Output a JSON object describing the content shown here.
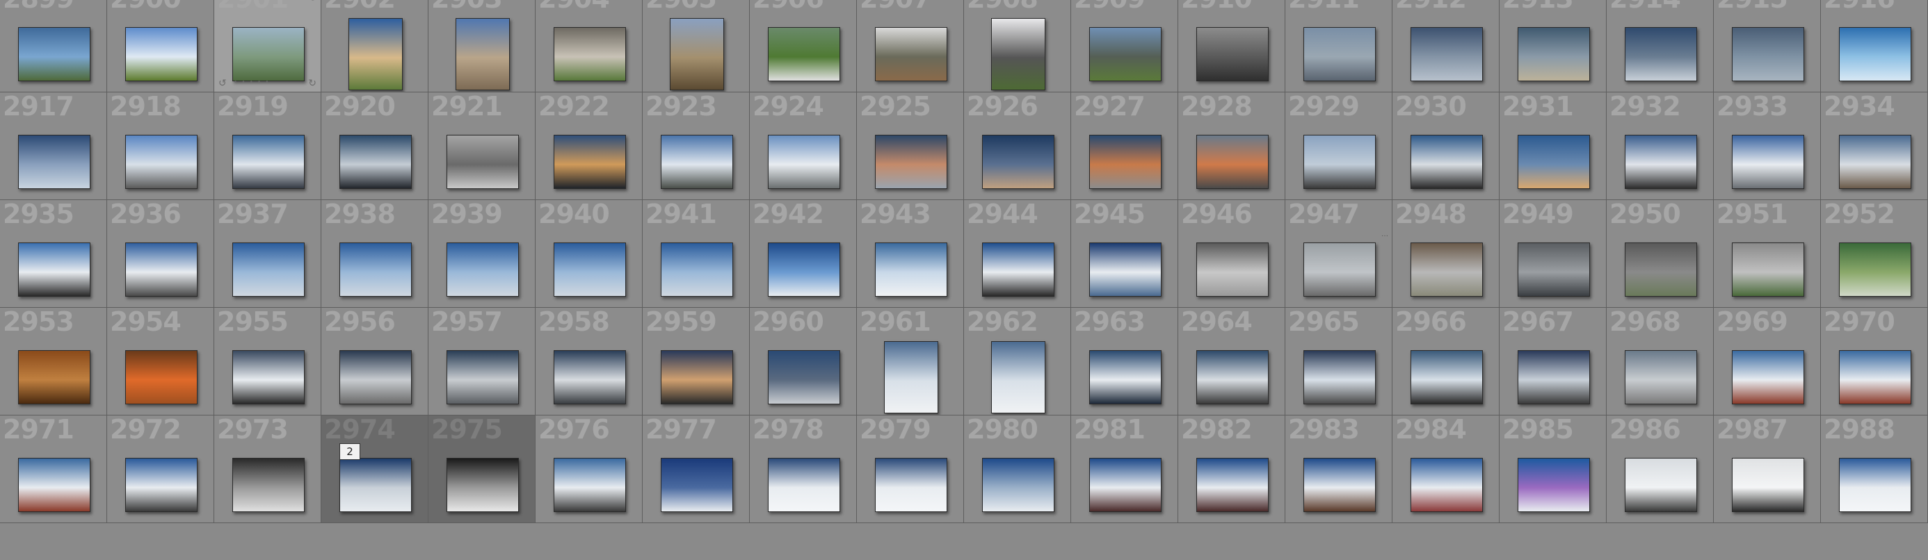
{
  "grid": {
    "columns": 18,
    "rows": 5,
    "first_number": 2899,
    "hover_number": 2901,
    "selected_numbers": [
      2974,
      2975
    ],
    "badge_on": 2974,
    "badge_label": "2",
    "portrait_numbers": [
      2902,
      2903,
      2905,
      2908,
      2961,
      2962
    ],
    "palette": {
      "cell_bg": "#8c8c8c",
      "cell_hover_bg": "#a0a0a0",
      "cell_selected_bg": "#6a6a6a",
      "number_color": "#a6a6a6",
      "border": "#5e5e5e"
    }
  },
  "icons": {
    "rotate_left": "rotate-left-icon",
    "rotate_right": "rotate-right-icon",
    "flag": "flag-icon",
    "rating_dots": "rating-dots-icon",
    "resize_grip": "resize-grip-icon"
  },
  "thumbnails": [
    [
      "#3f6a9a",
      "#7aa6d0",
      "#4f6a3a"
    ],
    [
      "#5e8ccc",
      "#dfe9f3",
      "#5d7b2e"
    ],
    [
      "#9bb3c4",
      "#7e9a7e",
      "#4f6b3f"
    ],
    [
      "#2e5f9f",
      "#d8b98a",
      "#5c7a3a"
    ],
    [
      "#5077b0",
      "#b9a58a",
      "#7d6b55"
    ],
    [
      "#6e6a62",
      "#c8c2b6",
      "#58783a"
    ],
    [
      "#8aa0c0",
      "#a4906e",
      "#5b4a32"
    ],
    [
      "#6a8a6a",
      "#4f7a33",
      "#e0e0e0"
    ],
    [
      "#d9d9d9",
      "#6a6a5a",
      "#8a6a4a"
    ],
    [
      "#e8e8ea",
      "#555",
      "#4e6a35"
    ],
    [
      "#6f8fb3",
      "#555f55",
      "#5b7a3a"
    ],
    [
      "#8c8c8c",
      "#5a5a5a",
      "#2f2f2f"
    ],
    [
      "#7a8fa6",
      "#9aa7b2",
      "#5a6470"
    ],
    [
      "#3d5270",
      "#8494a6",
      "#b7c1cc"
    ],
    [
      "#405a70",
      "#8a9aa8",
      "#bcb29a"
    ],
    [
      "#2f4a6e",
      "#6a7d92",
      "#c8d0d8"
    ],
    [
      "#4a5e76",
      "#7f92a4",
      "#a8b4c0"
    ],
    [
      "#2d6fb0",
      "#8ec0e4",
      "#d8e8f4"
    ],
    [
      "#2c4a75",
      "#8aa0bd",
      "#c8d4e0"
    ],
    [
      "#5a86c2",
      "#d8e0e8",
      "#5a5a5a"
    ],
    [
      "#3c6a9a",
      "#e0e6ec",
      "#353b44"
    ],
    [
      "#2c4a6a",
      "#c4ccd4",
      "#22262c"
    ],
    [
      "#a4a4a4",
      "#6a6a6a",
      "#c8c8c8"
    ],
    [
      "#2f4f7a",
      "#d09a5a",
      "#20242a"
    ],
    [
      "#4a74aa",
      "#dfe6ee",
      "#4a4f4a"
    ],
    [
      "#6a90c0",
      "#e8ecf0",
      "#6a6f70"
    ],
    [
      "#2e4868",
      "#c48a6a",
      "#9aa4ae"
    ],
    [
      "#1e3a60",
      "#5a7090",
      "#c0a080"
    ],
    [
      "#2a4a70",
      "#c87a4a",
      "#8c8c8c"
    ],
    [
      "#6a7a8a",
      "#d07a4a",
      "#4a4a4a"
    ],
    [
      "#8aa2c0",
      "#c0ccd8",
      "#3a3a3a"
    ],
    [
      "#2f5a8a",
      "#d8dde2",
      "#2a2a2a"
    ],
    [
      "#2c5a90",
      "#6a8ab0",
      "#d8a870"
    ],
    [
      "#3a5e8e",
      "#e0e4ea",
      "#2e2e2e"
    ],
    [
      "#3a64a0",
      "#e8ecf0",
      "#6a6f74"
    ],
    [
      "#4a6a90",
      "#d8dde2",
      "#6a5a4a"
    ],
    [
      "#3a70b0",
      "#e8ecf0",
      "#2a2a2a"
    ],
    [
      "#2f5f9f",
      "#e8ecf0",
      "#4a4a4a"
    ],
    [
      "#2a5c9c",
      "#9ab8d8",
      "#d0d8e0"
    ],
    [
      "#2a5c9c",
      "#9ab8d8",
      "#d0d8e0"
    ],
    [
      "#2a5c9c",
      "#9ab8d8",
      "#d0d8e0"
    ],
    [
      "#2a5c9c",
      "#9ab8d8",
      "#d0d8e0"
    ],
    [
      "#2a5c9c",
      "#9ab8d8",
      "#d0d8e0"
    ],
    [
      "#1e4a8a",
      "#6a9ad0",
      "#e8ecf0"
    ],
    [
      "#3a6a9e",
      "#c8d8e8",
      "#f0f2f4"
    ],
    [
      "#1f4f8f",
      "#e8ecf0",
      "#2a2a2a"
    ],
    [
      "#1a3a70",
      "#e8ecf0",
      "#4a6a90"
    ],
    [
      "#5a5a5a",
      "#c8c8c8",
      "#9a9a9a"
    ],
    [
      "#9aa0a4",
      "#c0c4c8",
      "#6a6a6a"
    ],
    [
      "#6a5a4a",
      "#b8b8b8",
      "#8a8a7a"
    ],
    [
      "#5a5e62",
      "#9a9ea2",
      "#3a3e42"
    ],
    [
      "#5a5a5a",
      "#8a8a8a",
      "#6a7a5a"
    ],
    [
      "#8a8a8a",
      "#c0c0c0",
      "#4a6a3a"
    ],
    [
      "#3a6a3a",
      "#8aa86a",
      "#d0d8c8"
    ],
    [
      "#8a4a1a",
      "#c08040",
      "#4a2a10"
    ],
    [
      "#6a3a1a",
      "#e06a2a",
      "#a05020"
    ],
    [
      "#3a4a60",
      "#e8ecf0",
      "#2a2a2a"
    ],
    [
      "#2a3a50",
      "#c8ccd0",
      "#6a6a6a"
    ],
    [
      "#2a3e56",
      "#c8ccd0",
      "#5a5e62"
    ],
    [
      "#2a3e58",
      "#d8dce0",
      "#3a3e42"
    ],
    [
      "#2a3a5a",
      "#d0a070",
      "#2a2a2a"
    ],
    [
      "#2a4a74",
      "#5a6a80",
      "#c8ccd0"
    ],
    [
      "#4a6a90",
      "#d8e0e8",
      "#f0f2f4"
    ],
    [
      "#4a6a90",
      "#d8e0e8",
      "#f0f2f4"
    ],
    [
      "#2a4a70",
      "#e8ecf0",
      "#1e2a3a"
    ],
    [
      "#2e4a6a",
      "#d8dde2",
      "#3a3a3a"
    ],
    [
      "#2a3a56",
      "#d8e0e8",
      "#4a4a4a"
    ],
    [
      "#3a5a7a",
      "#d8e0e8",
      "#2a2a2a"
    ],
    [
      "#2a3a5a",
      "#c8d0d8",
      "#3a3a3a"
    ],
    [
      "#6a7a8a",
      "#c8ccd0",
      "#7a7a7a"
    ],
    [
      "#3a6aa0",
      "#e8ecf0",
      "#8a3a2a"
    ],
    [
      "#3a6aa0",
      "#e8ecf0",
      "#8a3a2a"
    ],
    [
      "#3a6aa0",
      "#e8ecf0",
      "#8a3a2a"
    ],
    [
      "#2a5a9a",
      "#e8ecf0",
      "#3a3a3a"
    ],
    [
      "#2a2a2a",
      "#9a9a9a",
      "#e0e0e0"
    ],
    [
      "#1a3a6a",
      "#c8d0d8",
      "#e8ecf0"
    ],
    [
      "#1a1a1a",
      "#9a9a9a",
      "#e8e8e8"
    ],
    [
      "#3a6aa0",
      "#e8ecf0",
      "#3a3a3a"
    ],
    [
      "#1a3a7a",
      "#4a6aa0",
      "#e8ecf0"
    ],
    [
      "#2a4a7a",
      "#e8ecf0",
      "#f4f6f8"
    ],
    [
      "#2a4a7a",
      "#e8ecf0",
      "#f4f6f8"
    ],
    [
      "#1e4a8a",
      "#9ab0c8",
      "#e8ecf0"
    ],
    [
      "#1e4a8a",
      "#e8ecf0",
      "#4a2a2a"
    ],
    [
      "#1e4a8a",
      "#e8ecf0",
      "#4a2a2a"
    ],
    [
      "#1e4a8a",
      "#e8ecf0",
      "#5a3a2a"
    ],
    [
      "#2a5a9a",
      "#e8ecf0",
      "#8a3a3a"
    ],
    [
      "#1e5aa0",
      "#9a6ac0",
      "#e8ecf0"
    ],
    [
      "#d8dce0",
      "#f0f2f4",
      "#3a3a3a"
    ],
    [
      "#e0e2e4",
      "#f4f5f6",
      "#2a2a2a"
    ],
    [
      "#2a5a9a",
      "#e8ecf0",
      "#f4f6f8"
    ]
  ]
}
